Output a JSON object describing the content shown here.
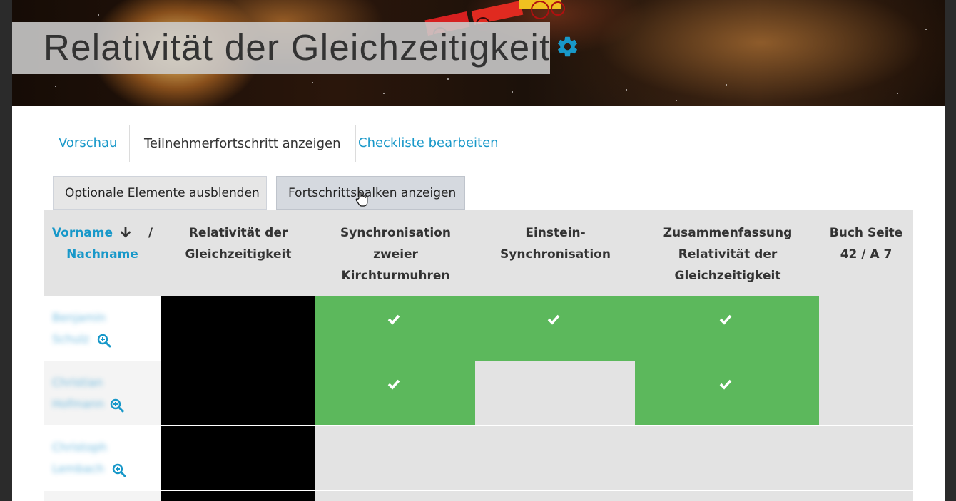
{
  "header": {
    "title": "Relativität der Gleichzeitigkeit",
    "settings_icon": "gear-icon",
    "accent_color": "#1898c9"
  },
  "tabs": [
    {
      "label": "Vorschau",
      "active": false
    },
    {
      "label": "Teilnehmerfortschritt anzeigen",
      "active": true
    },
    {
      "label": "Checkliste bearbeiten",
      "active": false
    }
  ],
  "buttons": {
    "hide_optional": "Optionale Elemente ausblenden",
    "show_progress": "Fortschrittsbalken anzeigen"
  },
  "table": {
    "name_header": {
      "first": "Vorname",
      "sort_icon": "arrow-down-icon",
      "separator": "/",
      "last": "Nachname"
    },
    "columns": [
      "Relativität der Gleichzeitigkeit",
      "Synchronisation zweier Kirchturmuhren",
      "Einstein-Synchronisation",
      "Zusammenfassung Relativität der Gleichzeitigkeit",
      "Buch Seite 42 / A 7"
    ],
    "rows": [
      {
        "name_line1": "Benjamin",
        "name_line2": "Schulz",
        "status": [
          "blank",
          "done",
          "done",
          "done",
          "none"
        ]
      },
      {
        "name_line1": "Christian",
        "name_line2": "Hofmann",
        "status": [
          "blank",
          "done",
          "none",
          "done",
          "none"
        ]
      },
      {
        "name_line1": "Christoph",
        "name_line2": "Lembach",
        "status": [
          "blank",
          "none",
          "none",
          "none",
          "none"
        ]
      }
    ],
    "status_colors": {
      "done": "#5cb85c",
      "none": "#e3e3e3",
      "blank": "#000000"
    }
  }
}
